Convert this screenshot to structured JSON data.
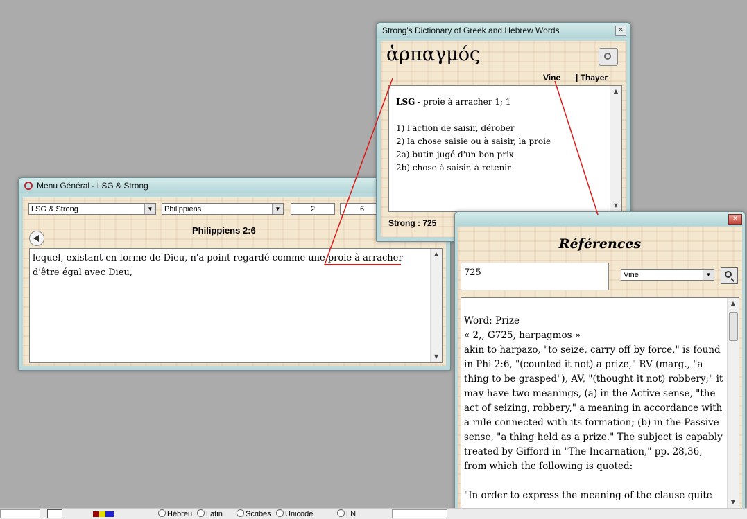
{
  "menu_window": {
    "title": "Menu Général - LSG & Strong",
    "version_select": "LSG & Strong",
    "book_select": "Philippiens",
    "chapter": "2",
    "verse": "6",
    "reference": "Philippiens 2:6",
    "verse_before": "lequel, existant en forme de Dieu, n'a point regardé comme une ",
    "verse_highlight": "proie à arracher",
    "verse_after": " d'être égal avec Dieu,"
  },
  "strong_window": {
    "title": "Strong's Dictionary of Greek and Hebrew Words",
    "greek_word": "ἁρπαγμός",
    "tab_vine": "Vine",
    "tab_thayer": "| Thayer",
    "lsg_label": "LSG",
    "lsg_text": " - proie à arracher 1; 1",
    "definitions": [
      "1) l'action de saisir, dérober",
      "2) la chose saisie ou à saisir, la proie",
      "2a) butin jugé d'un bon prix",
      "2b) chose à saisir, à retenir"
    ],
    "footer": "Strong : 725"
  },
  "ref_window": {
    "title": "Références",
    "search_value": "725",
    "source_select": "Vine",
    "paragraphs": [
      "Word: Prize",
      " « 2,, G725, harpagmos »",
      " akin to harpazo, \"to seize, carry off by force,\" is found in Phi 2:6, \"(counted it not) a prize,\" RV (marg., \"a thing to be grasped\"), AV, \"(thought it not) robbery;\" it may have two meanings, (a) in the Active sense, \"the act of seizing, robbery,\" a meaning in accordance with a rule connected with its formation; (b) in the Passive sense, \"a thing held as a prize.\" The subject is capably treated by Gifford in \"The Incarnation,\" pp. 28,36, from which the following is quoted:",
      "",
      " \"In order to express the meaning of the clause quite"
    ]
  },
  "taskbar": {
    "radios": [
      "Hébreu",
      "Latin",
      "Scribes",
      "Unicode",
      "LN"
    ]
  },
  "colors": {
    "annotation": "#e01818",
    "window_frame": "#bcd9db",
    "parchment": "#f4e7d0"
  },
  "icons": [
    "app-logo-icon",
    "close-icon",
    "speaker-icon",
    "search-book-icon",
    "back-arrow-icon"
  ]
}
